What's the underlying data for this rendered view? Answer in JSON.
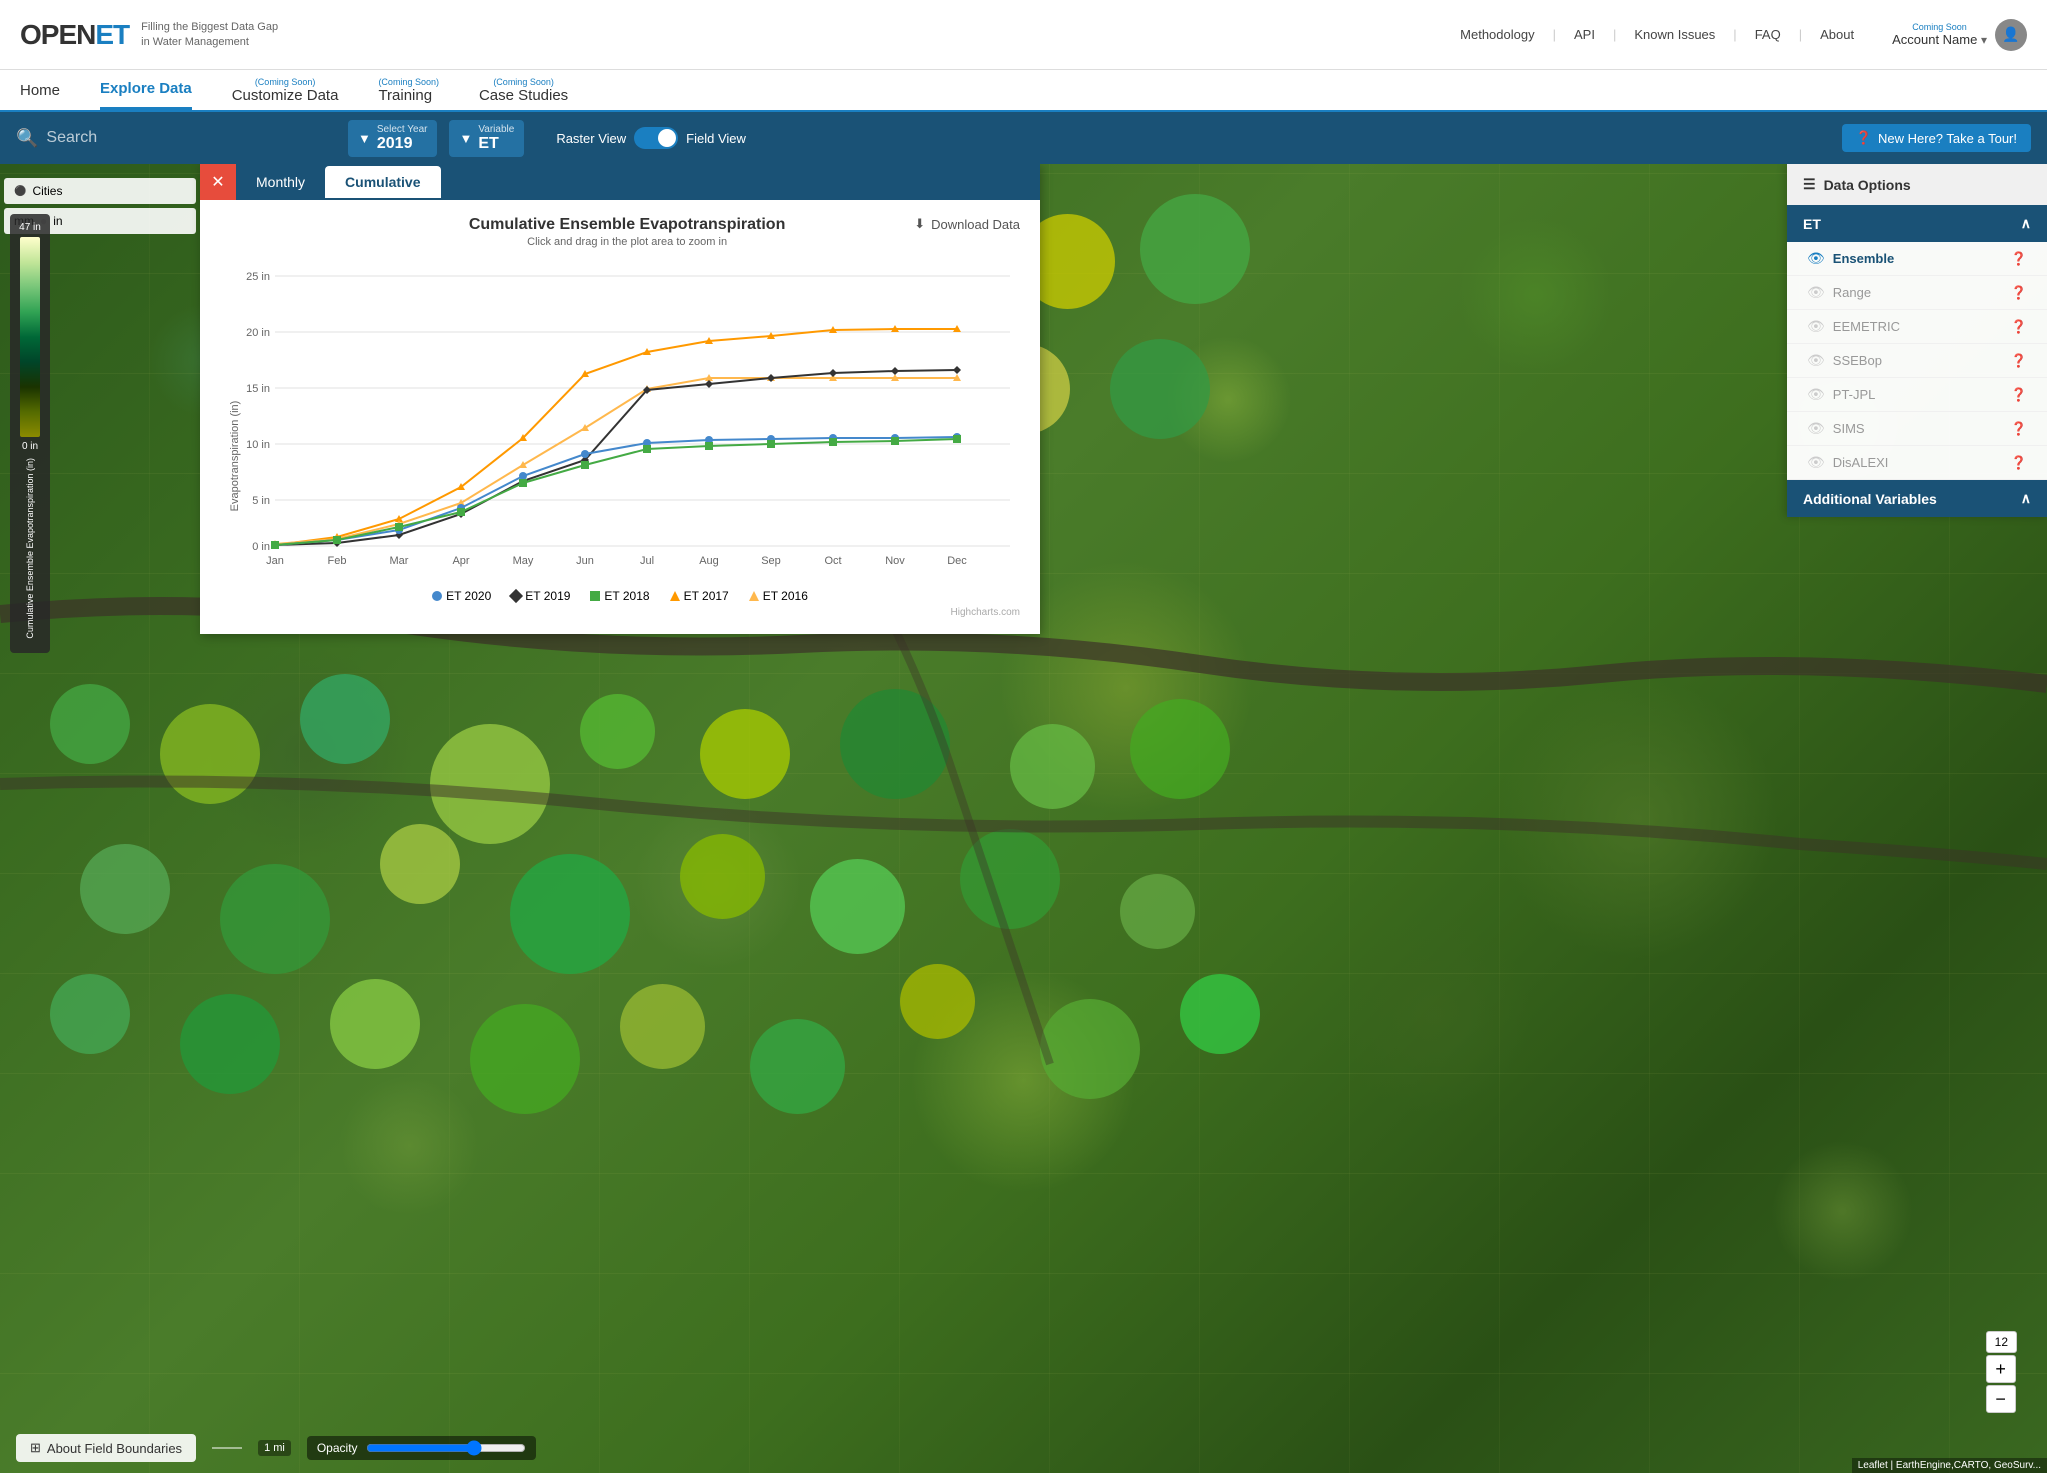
{
  "site": {
    "logo": "OPEN",
    "logo_highlight": "ET",
    "subtitle_line1": "Filling the Biggest Data Gap",
    "subtitle_line2": "in Water Management"
  },
  "top_nav": {
    "links": [
      "Methodology",
      "API",
      "Known Issues",
      "FAQ",
      "About"
    ],
    "account": {
      "label": "Account Name",
      "coming_soon": "Coming Soon"
    }
  },
  "second_nav": {
    "links": [
      "Home",
      "Explore Data",
      "Customize Data",
      "Training",
      "Case Studies"
    ],
    "coming_soon_items": [
      "Customize Data",
      "Training",
      "Case Studies"
    ],
    "active": "Explore Data"
  },
  "toolbar": {
    "search_placeholder": "Search",
    "select_year_label": "Select Year",
    "select_year_value": "2019",
    "variable_label": "Variable",
    "variable_value": "ET",
    "raster_view": "Raster View",
    "field_view": "Field View",
    "new_here_btn": "New Here? Take a Tour!"
  },
  "chart": {
    "tab_monthly": "Monthly",
    "tab_cumulative": "Cumulative",
    "active_tab": "Cumulative",
    "title": "Cumulative Ensemble Evapotranspiration",
    "subtitle": "Click and drag in the plot area to zoom in",
    "download_btn": "Download Data",
    "y_axis_label": "Evapotranspiration (in)",
    "x_axis_label": "Evapotranspiration (in)",
    "y_ticks": [
      "0 in",
      "5 in",
      "10 in",
      "15 in",
      "20 in",
      "25 in"
    ],
    "x_months": [
      "Jan",
      "Feb",
      "Mar",
      "Apr",
      "May",
      "Jun",
      "Jul",
      "Aug",
      "Sep",
      "Oct",
      "Nov",
      "Dec"
    ],
    "legend": [
      {
        "label": "ET 2020",
        "color": "#4488cc",
        "type": "circle"
      },
      {
        "label": "ET 2019",
        "color": "#333333",
        "type": "circle"
      },
      {
        "label": "ET 2018",
        "color": "#44aa44",
        "type": "circle"
      },
      {
        "label": "ET 2017",
        "color": "#ff9900",
        "type": "circle"
      },
      {
        "label": "ET 2016",
        "color": "#ff9900",
        "type": "triangle"
      }
    ],
    "credit": "Highcharts.com",
    "series": {
      "et2020": [
        0.1,
        0.5,
        1.5,
        3.5,
        6.5,
        8.5,
        9.5,
        9.8,
        9.9,
        10.0,
        10.0,
        10.1
      ],
      "et2019": [
        0.1,
        0.3,
        1.0,
        3.0,
        6.0,
        8.0,
        14.5,
        15.0,
        15.5,
        16.0,
        16.2,
        16.3
      ],
      "et2018": [
        0.1,
        0.5,
        1.8,
        3.2,
        5.8,
        7.5,
        9.0,
        9.3,
        9.5,
        9.7,
        9.8,
        9.9
      ],
      "et2017": [
        0.1,
        0.8,
        2.5,
        5.5,
        10.0,
        16.0,
        18.0,
        19.0,
        19.5,
        20.0,
        20.2,
        20.2
      ],
      "et2016": [
        0.2,
        0.6,
        2.0,
        4.0,
        7.5,
        11.0,
        14.5,
        15.5,
        15.5,
        15.5,
        15.5,
        15.5
      ]
    }
  },
  "right_panel": {
    "header": "Data Options",
    "section_et": "ET",
    "et_items": [
      {
        "label": "Ensemble",
        "active": true
      },
      {
        "label": "Range",
        "active": false
      },
      {
        "label": "EEMETRIC",
        "active": false
      },
      {
        "label": "SSEBop",
        "active": false
      },
      {
        "label": "PT-JPL",
        "active": false
      },
      {
        "label": "SIMS",
        "active": false
      },
      {
        "label": "DisALEXI",
        "active": false
      }
    ],
    "section_additional": "Additional Variables"
  },
  "bottom": {
    "about_btn": "About Field Boundaries",
    "opacity_label": "Opacity",
    "zoom_level": "12",
    "zoom_in": "+",
    "zoom_out": "−",
    "leaflet_credit": "Leaflet | EarthEngine,CARTO, GeoSurv..."
  },
  "map": {
    "legend_top": "47 in",
    "legend_bottom": "0 in",
    "legend_label": "Cumulative Ensemble Evapotranspiration (in)",
    "cities_label": "Cities",
    "unit_mm": "mm",
    "unit_in": "in"
  }
}
